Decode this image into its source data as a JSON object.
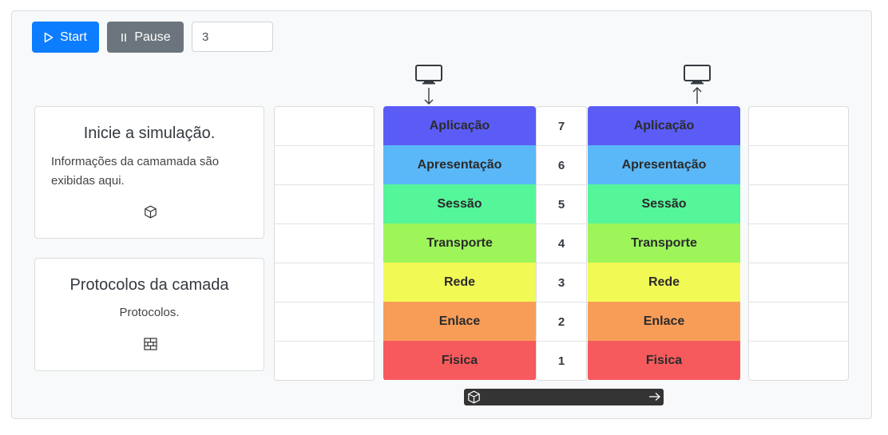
{
  "controls": {
    "start_label": "Start",
    "pause_label": "Pause",
    "speed_value": "3"
  },
  "info_card": {
    "title": "Inicie a simulação.",
    "text": "Informações da camamada são exibidas aqui."
  },
  "protocol_card": {
    "title": "Protocolos da camada",
    "text": "Protocolos."
  },
  "layers": [
    {
      "name": "Aplicação",
      "number": "7",
      "color": "#5b5cf6"
    },
    {
      "name": "Apresentação",
      "number": "6",
      "color": "#5ab8f8"
    },
    {
      "name": "Sessão",
      "number": "5",
      "color": "#55f59a"
    },
    {
      "name": "Transporte",
      "number": "4",
      "color": "#9df55a"
    },
    {
      "name": "Rede",
      "number": "3",
      "color": "#f1f955"
    },
    {
      "name": "Enlace",
      "number": "2",
      "color": "#f89d58"
    },
    {
      "name": "Fisica",
      "number": "1",
      "color": "#f65a5d"
    }
  ],
  "icons": {
    "start": "play-icon",
    "pause": "pause-icon",
    "info": "package-icon",
    "protocol": "brick-wall-icon",
    "sender": "monitor-icon",
    "receiver": "monitor-icon",
    "packet": "package-icon",
    "direction": "arrow-right-icon"
  }
}
